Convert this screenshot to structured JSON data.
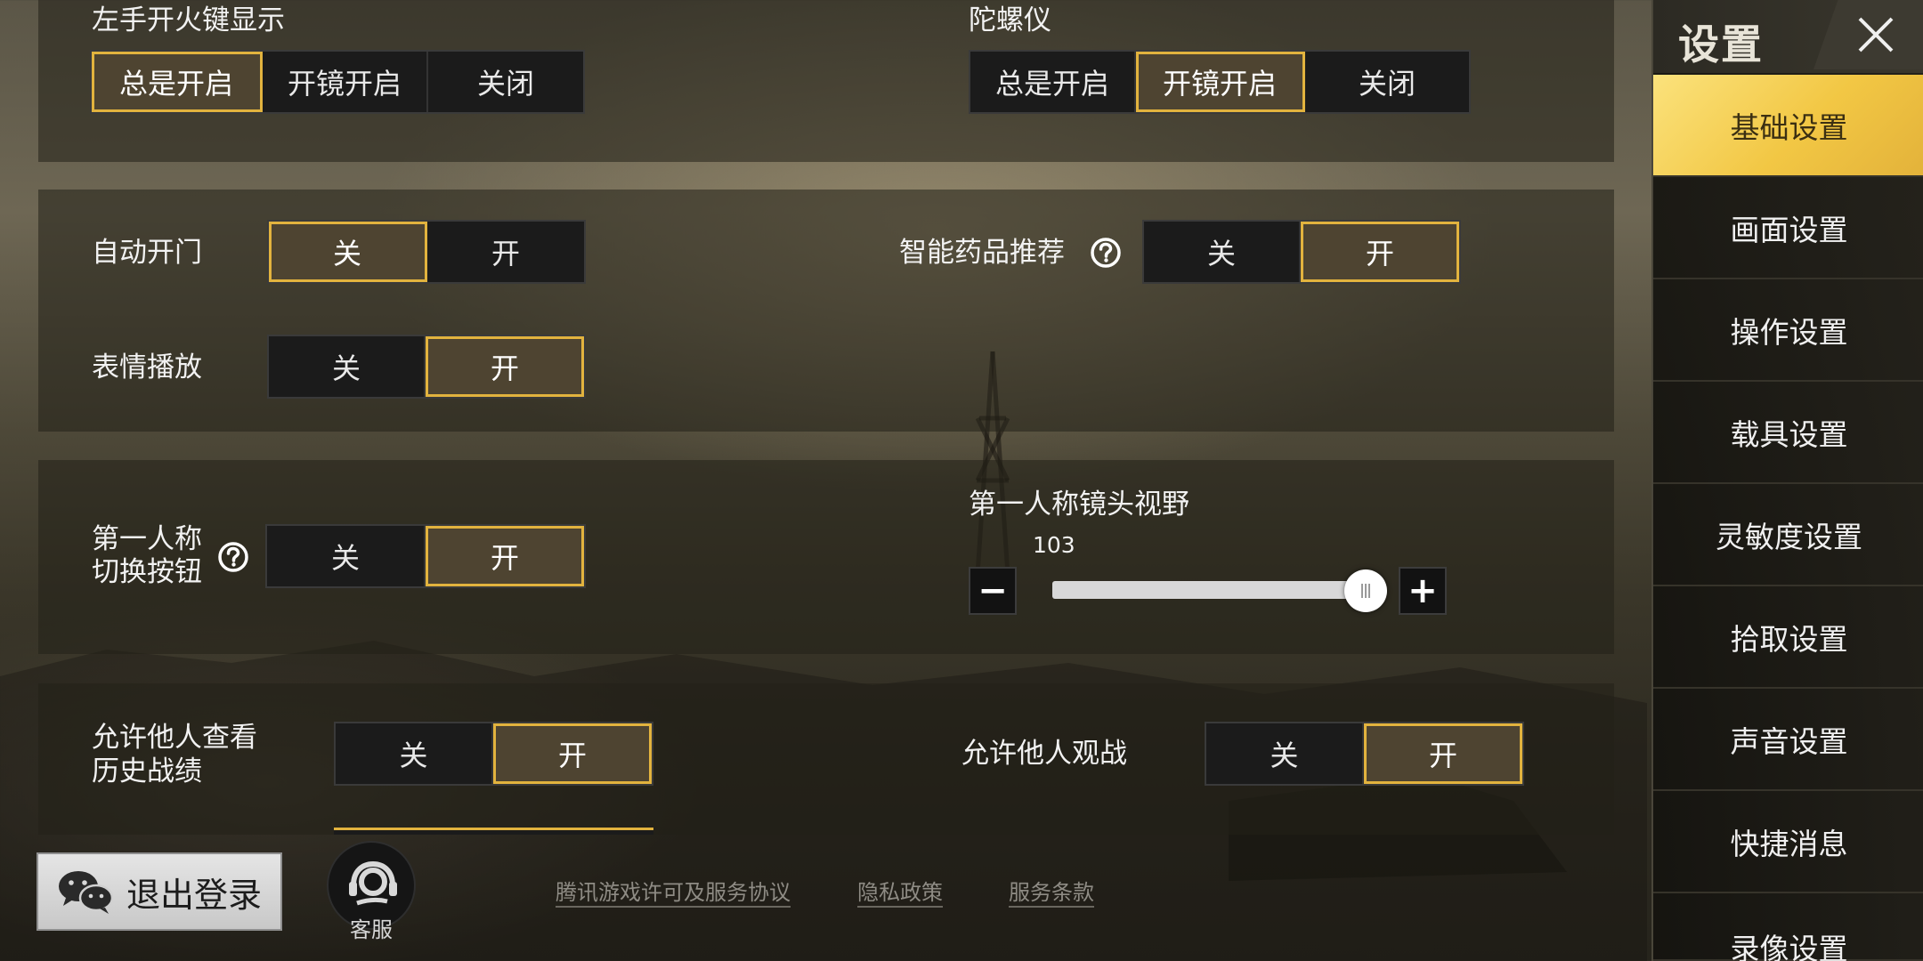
{
  "settings": {
    "fire_button": {
      "label": "左手开火键显示",
      "options": [
        "总是开启",
        "开镜开启",
        "关闭"
      ],
      "selected": "总是开启"
    },
    "gyroscope": {
      "label": "陀螺仪",
      "options": [
        "总是开启",
        "开镜开启",
        "关闭"
      ],
      "selected": "开镜开启"
    },
    "auto_door": {
      "label": "自动开门",
      "options": [
        "关",
        "开"
      ],
      "selected": "关"
    },
    "smart_medicine": {
      "label": "智能药品推荐",
      "options": [
        "关",
        "开"
      ],
      "selected": "开"
    },
    "emote_play": {
      "label": "表情播放",
      "options": [
        "关",
        "开"
      ],
      "selected": "开"
    },
    "fpp_switch": {
      "label_line1": "第一人称",
      "label_line2": "切换按钮",
      "options": [
        "关",
        "开"
      ],
      "selected": "开"
    },
    "fpp_fov": {
      "label": "第一人称镜头视野",
      "value": "103",
      "minus": "−",
      "plus": "+"
    },
    "view_history": {
      "label_line1": "允许他人查看",
      "label_line2": "历史战绩",
      "options": [
        "关",
        "开"
      ],
      "selected": "开"
    },
    "spectate": {
      "label": "允许他人观战",
      "options": [
        "关",
        "开"
      ],
      "selected": "开"
    }
  },
  "sidebar": {
    "title": "设置",
    "items": [
      {
        "label": "基础设置",
        "active": true
      },
      {
        "label": "画面设置",
        "active": false
      },
      {
        "label": "操作设置",
        "active": false
      },
      {
        "label": "载具设置",
        "active": false
      },
      {
        "label": "灵敏度设置",
        "active": false
      },
      {
        "label": "拾取设置",
        "active": false
      },
      {
        "label": "声音设置",
        "active": false
      },
      {
        "label": "快捷消息",
        "active": false
      },
      {
        "label": "录像设置",
        "active": false
      }
    ]
  },
  "footer": {
    "logout_label": "退出登录",
    "customer_service_label": "客服",
    "links": [
      "腾讯游戏许可及服务协议",
      "隐私政策",
      "服务条款"
    ]
  },
  "colors": {
    "accent_gold": "#e2b33e",
    "active_fill": "#4e4431",
    "sidebar_active": "#f2c744"
  }
}
